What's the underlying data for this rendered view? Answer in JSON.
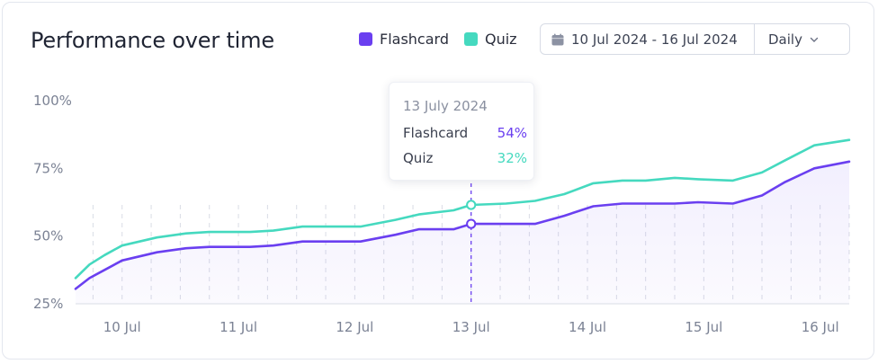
{
  "header": {
    "title": "Performance over time",
    "date_range": "10 Jul 2024 - 16 Jul 2024",
    "period": "Daily"
  },
  "tooltip": {
    "date": "13 July 2024",
    "rows": [
      {
        "label": "Flashcard",
        "value": "54%"
      },
      {
        "label": "Quiz",
        "value": "32%"
      }
    ]
  },
  "colors": {
    "flashcard": "#6a3ff0",
    "quiz": "#45d9bf",
    "grid": "#d9dce5"
  },
  "chart_data": {
    "type": "line",
    "title": "Performance over time",
    "xlabel": "",
    "ylabel": "",
    "categories": [
      "10 Jul",
      "11 Jul",
      "12 Jul",
      "13 Jul",
      "14 Jul",
      "15 Jul",
      "16 Jul"
    ],
    "yticks": [
      "25%",
      "50%",
      "75%",
      "100%"
    ],
    "ylim": [
      25,
      100
    ],
    "xlim": [
      9.6,
      16.25
    ],
    "grid": "vertical dashed",
    "legend": "top",
    "series": [
      {
        "name": "Flashcard",
        "color": "#6a3ff0",
        "x": [
          9.6,
          9.72,
          9.85,
          10.0,
          10.3,
          10.55,
          10.75,
          11.1,
          11.3,
          11.55,
          11.85,
          12.05,
          12.35,
          12.55,
          12.85,
          13.0,
          13.3,
          13.55,
          13.8,
          14.05,
          14.3,
          14.5,
          14.75,
          14.95,
          15.25,
          15.5,
          15.7,
          15.95,
          16.25
        ],
        "values": [
          30.5,
          34.5,
          37.5,
          41,
          44,
          45.5,
          46,
          46,
          46.5,
          48,
          48,
          48,
          50.5,
          52.5,
          52.5,
          54.5,
          54.5,
          54.5,
          57.5,
          61,
          62,
          62,
          62,
          62.5,
          62,
          65,
          70,
          75,
          77.5
        ]
      },
      {
        "name": "Quiz",
        "color": "#45d9bf",
        "x": [
          9.6,
          9.72,
          9.85,
          10.0,
          10.3,
          10.55,
          10.75,
          11.1,
          11.3,
          11.55,
          11.85,
          12.05,
          12.35,
          12.55,
          12.85,
          13.0,
          13.3,
          13.55,
          13.8,
          14.05,
          14.3,
          14.5,
          14.75,
          14.95,
          15.25,
          15.5,
          15.7,
          15.95,
          16.25
        ],
        "values": [
          34.5,
          39.5,
          43,
          46.5,
          49.5,
          51,
          51.5,
          51.5,
          52,
          53.5,
          53.5,
          53.5,
          56,
          58,
          59.5,
          61.5,
          62,
          63,
          65.5,
          69.5,
          70.5,
          70.5,
          71.5,
          71,
          70.5,
          73.5,
          78,
          83.5,
          85.5
        ]
      }
    ],
    "highlight": {
      "x": 13.0,
      "flashcard": 54.5,
      "quiz": 61.5
    }
  }
}
